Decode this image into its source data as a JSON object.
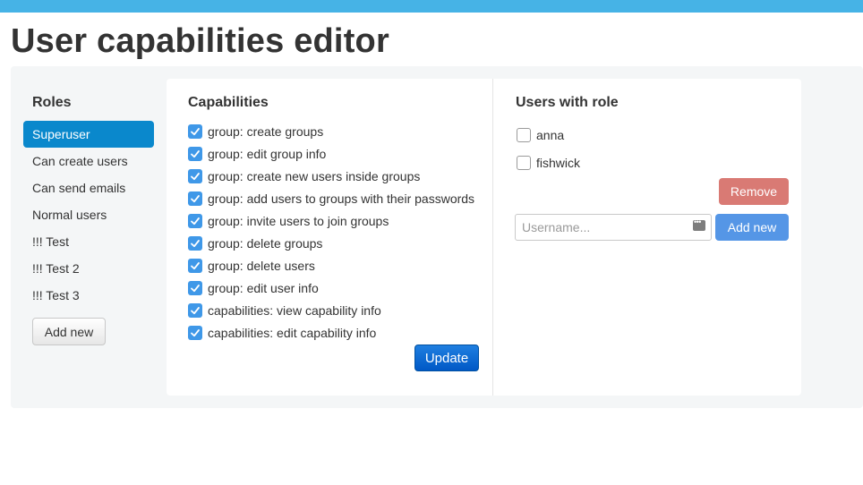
{
  "page": {
    "title": "User capabilities editor"
  },
  "roles": {
    "heading": "Roles",
    "items": [
      "Superuser",
      "Can create users",
      "Can send emails",
      "Normal users",
      "!!! Test",
      "!!! Test 2",
      "!!! Test 3"
    ],
    "add_label": "Add new"
  },
  "capabilities": {
    "heading": "Capabilities",
    "items": [
      "group: create groups",
      "group: edit group info",
      "group: create new users inside groups",
      "group: add users to groups with their passwords",
      "group: invite users to join groups",
      "group: delete groups",
      "group: delete users",
      "group: edit user info",
      "capabilities: view capability info",
      "capabilities: edit capability info"
    ],
    "update_label": "Update"
  },
  "users": {
    "heading": "Users with role",
    "items": [
      "anna",
      "fishwick"
    ],
    "remove_label": "Remove",
    "username_placeholder": "Username...",
    "add_label": "Add new"
  },
  "colors": {
    "topbar": "#46b3e6",
    "active_role": "#0a88cc",
    "checkbox": "#3f98e8",
    "update": "#0058c6",
    "remove": "#d97a74",
    "add_new": "#5596e6"
  }
}
